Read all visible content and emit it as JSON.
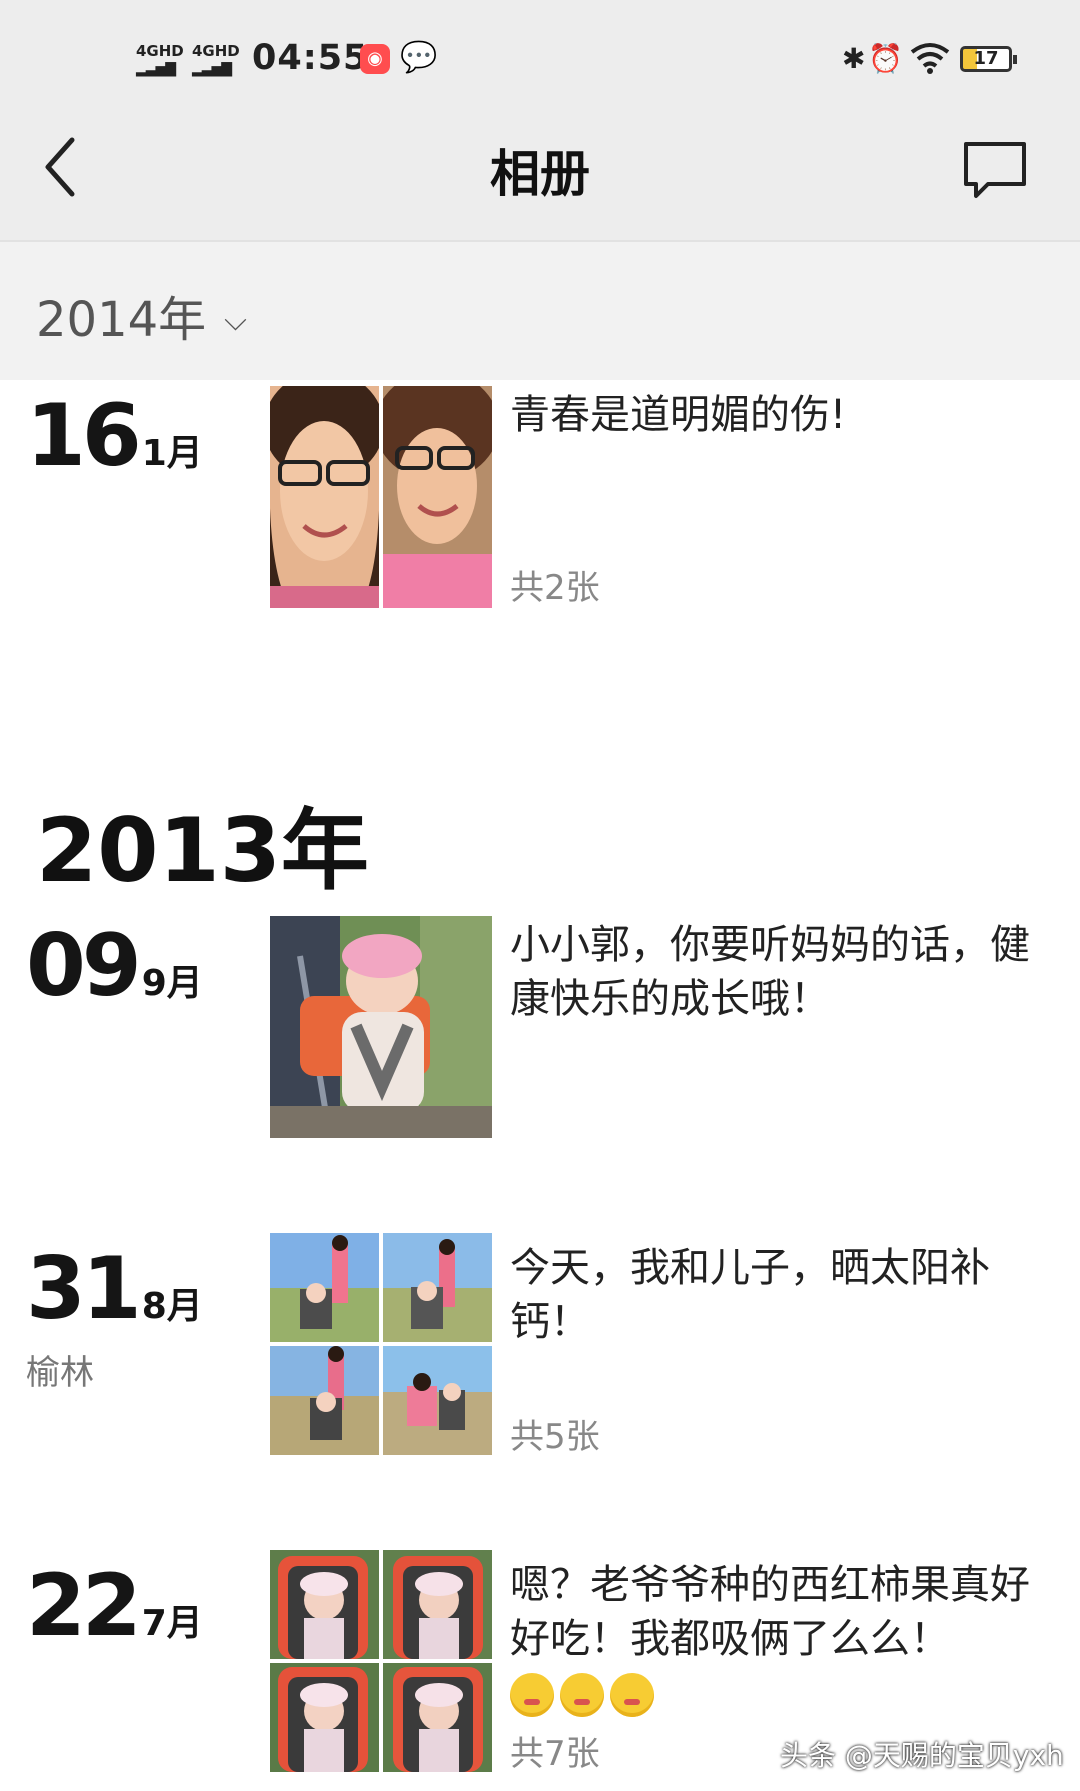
{
  "status_bar": {
    "sig1": "4GHD",
    "sig2": "4GHD",
    "time": "04:55",
    "battery": "17"
  },
  "header": {
    "title": "相册"
  },
  "year_selector": {
    "label": "2014年"
  },
  "sections": [
    {
      "year_heading": "",
      "entries": [
        {
          "day": "16",
          "month": "1月",
          "location": "",
          "caption": "青春是道明媚的伤!",
          "count": "共2张"
        }
      ]
    },
    {
      "year_heading": "2013年",
      "entries": [
        {
          "day": "09",
          "month": "9月",
          "location": "",
          "caption": "小小郭，你要听妈妈的话，健康快乐的成长哦！",
          "count": ""
        },
        {
          "day": "31",
          "month": "8月",
          "location": "榆林",
          "caption": "今天，我和儿子，晒太阳补钙！",
          "count": "共5张"
        },
        {
          "day": "22",
          "month": "7月",
          "location": "",
          "caption": "嗯？老爷爷种的西红柿果真好好吃！我都吸俩了么么！",
          "count": "共7张"
        }
      ]
    }
  ],
  "watermark": "头条 @天赐的宝贝yxh",
  "colors": {
    "header_bg": "#ededed",
    "year_bar_bg": "#f2f2f2",
    "count_text": "#888888"
  }
}
